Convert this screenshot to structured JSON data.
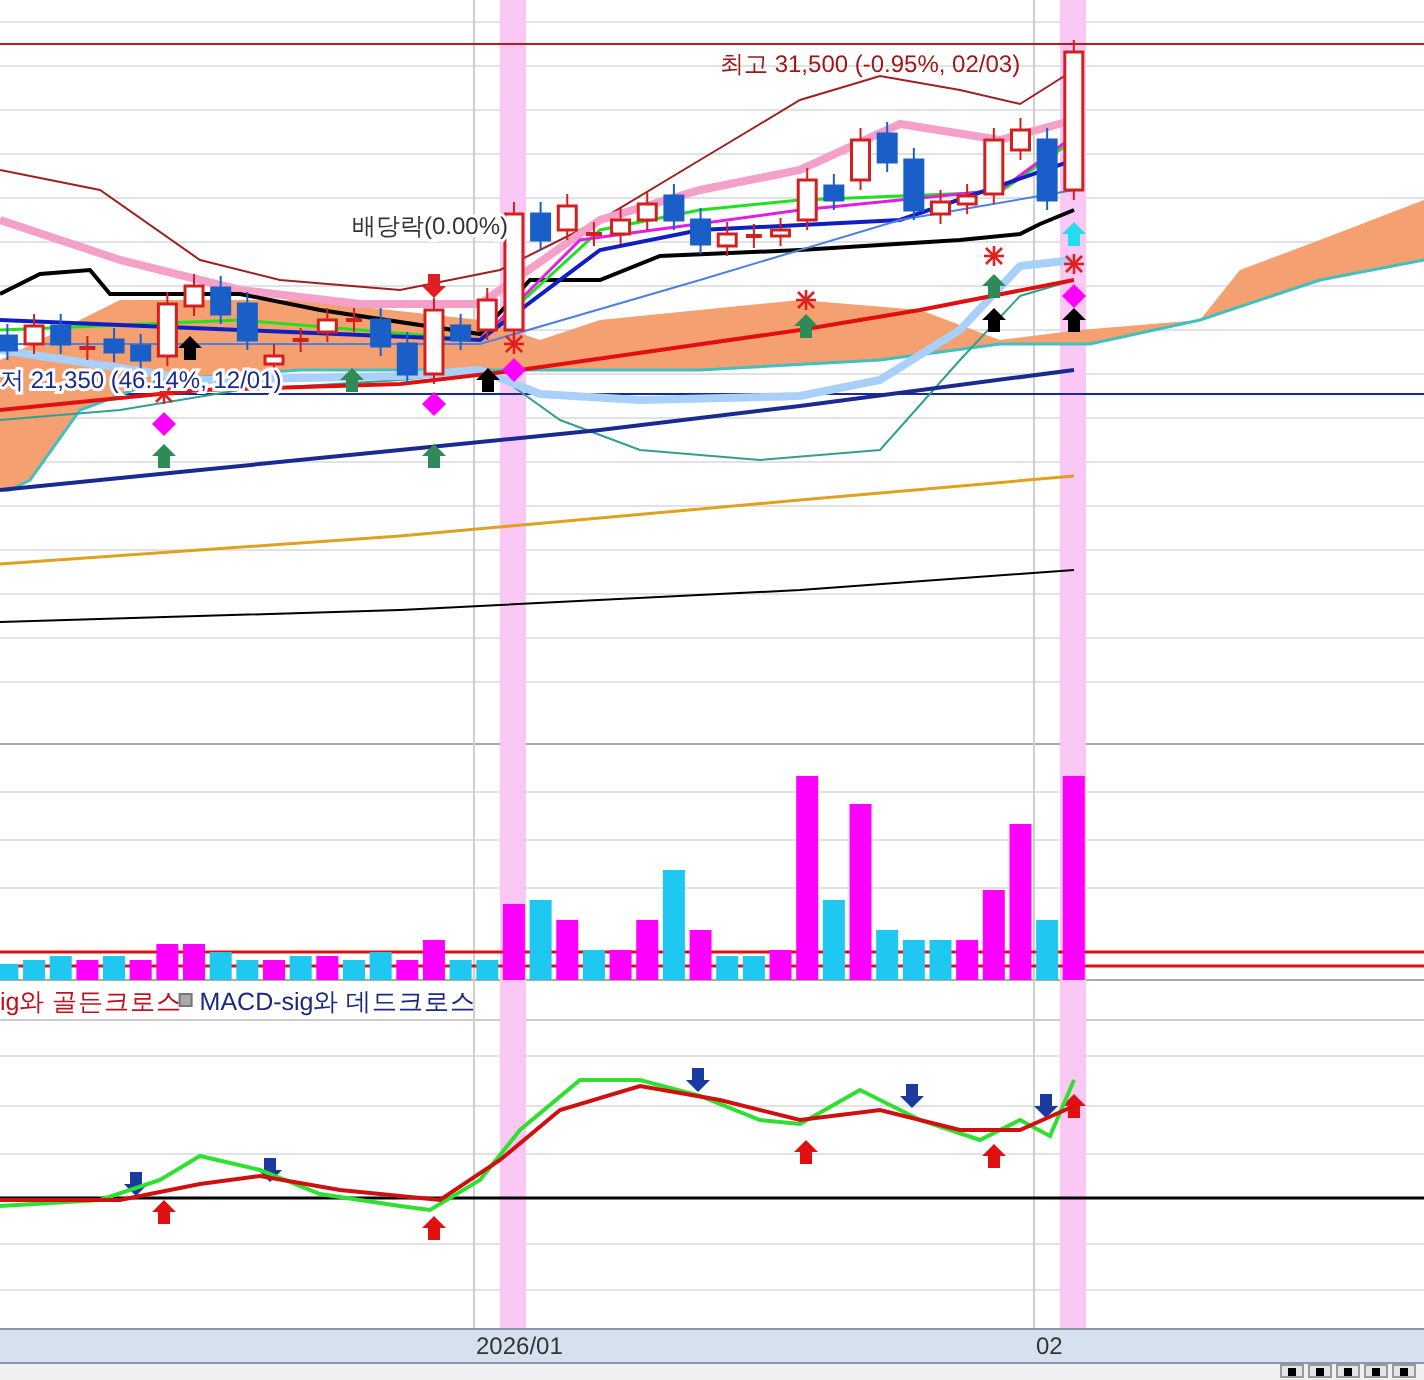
{
  "price_panel": {
    "high_label": "최고 31,500 (-0.95%, 02/03)",
    "low_label": "저 21,350 (46.14%, 12/01)",
    "dividend_label": "배당락(0.00%)"
  },
  "legend": [
    {
      "text": "ig와 골든크로스",
      "kind": "golden"
    },
    {
      "text": "MACD-sig와 데드크로스",
      "kind": "dead"
    }
  ],
  "x_axis": {
    "labels": [
      "2026/01",
      "02"
    ]
  }
}
